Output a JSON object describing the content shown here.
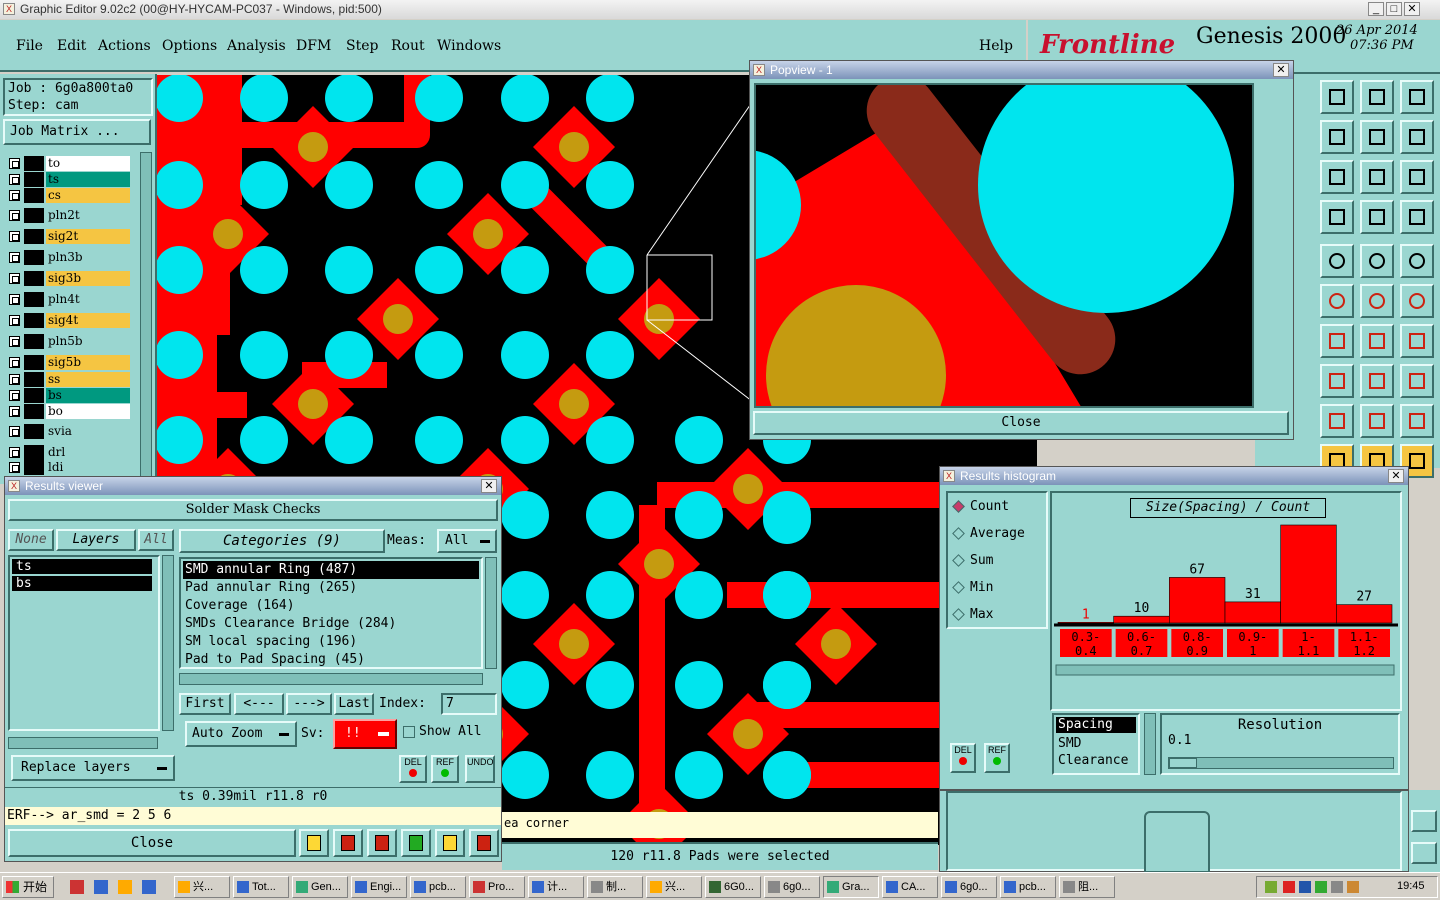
{
  "window": {
    "title": "Graphic Editor 9.02c2 (00@HY-HYCAM-PC037 - Windows, pid:500)"
  },
  "menu": [
    "File",
    "Edit",
    "Actions",
    "Options",
    "Analysis",
    "DFM",
    "Step",
    "Rout",
    "Windows"
  ],
  "help": "Help",
  "brand": {
    "logo": "Frontline",
    "product": "Genesis 2000",
    "date": "26 Apr 2014",
    "time": "07:36 PM"
  },
  "job": {
    "job_label": "Job  :  6g0a800ta0",
    "step_label": "Step: cam",
    "matrix_button": "Job Matrix ..."
  },
  "layers": [
    {
      "name": "to",
      "color": "#ffffff"
    },
    {
      "name": "ts",
      "color": "#009980"
    },
    {
      "name": "cs",
      "color": "#f5c542"
    },
    {
      "name": "pln2t",
      "color": "#9ad6d0"
    },
    {
      "name": "sig2t",
      "color": "#f5c542"
    },
    {
      "name": "pln3b",
      "color": "#9ad6d0"
    },
    {
      "name": "sig3b",
      "color": "#f5c542"
    },
    {
      "name": "pln4t",
      "color": "#9ad6d0"
    },
    {
      "name": "sig4t",
      "color": "#f5c542"
    },
    {
      "name": "pln5b",
      "color": "#9ad6d0"
    },
    {
      "name": "sig5b",
      "color": "#f5c542"
    },
    {
      "name": "ss",
      "color": "#f5c542"
    },
    {
      "name": "bs",
      "color": "#009980"
    },
    {
      "name": "bo",
      "color": "#ffffff"
    },
    {
      "name": "svia",
      "color": "#9ad6d0"
    },
    {
      "name": "drl",
      "color": "#9ad6d0"
    },
    {
      "name": "ldi",
      "color": "#9ad6d0"
    }
  ],
  "popview": {
    "title": "Popview - 1",
    "close": "Close"
  },
  "results_viewer": {
    "title": "Results viewer",
    "header": "Solder Mask Checks",
    "none": "None",
    "layers": "Layers",
    "all": "All",
    "layer_list": [
      "ts",
      "bs"
    ],
    "categories_label": "Categories (9)",
    "meas_label": "Meas:",
    "meas_value": "All",
    "categories": [
      "SMD annular Ring (487)",
      "Pad annular Ring (265)",
      "Coverage (164)",
      "SMDs Clearance Bridge (284)",
      "SM local spacing (196)",
      "Pad to Pad Spacing (45)"
    ],
    "first": "First",
    "prev": "<---",
    "next": "--->",
    "last": "Last",
    "index_label": "Index:",
    "index_value": "7",
    "auto_zoom": "Auto Zoom",
    "sv_label": "Sv:",
    "sv_value": "!!",
    "show_all": "Show All",
    "replace_layers": "Replace layers",
    "del": "DEL",
    "ref": "REF",
    "undo": "UNDO",
    "status": "ts 0.39mil   r11.8   r0",
    "erf": "ERF--> ar_smd = 2 5 6",
    "close": "Close"
  },
  "histogram": {
    "title": "Results histogram",
    "modes": [
      "Count",
      "Average",
      "Sum",
      "Min",
      "Max"
    ],
    "selected_mode": "Count",
    "chart_title": "Size(Spacing) / Count",
    "buckets": [
      {
        "label": "0.3-0.4",
        "count": 1
      },
      {
        "label": "0.6-0.7",
        "count": 10
      },
      {
        "label": "0.8-0.9",
        "count": 67
      },
      {
        "label": "0.9-1",
        "count": 31
      },
      {
        "label": "1-1.1",
        "count": 144
      },
      {
        "label": "1.1-1.2",
        "count": 27
      }
    ],
    "list": [
      "Spacing",
      "SMD",
      "Clearance"
    ],
    "resolution_label": "Resolution",
    "resolution_value": "0.1",
    "del": "DEL",
    "ref": "REF"
  },
  "chart_data": {
    "type": "bar",
    "title": "Size(Spacing) / Count",
    "categories": [
      "0.3-0.4",
      "0.6-0.7",
      "0.8-0.9",
      "0.9-1",
      "1-1.1",
      "1.1-1.2"
    ],
    "values": [
      1,
      10,
      67,
      31,
      144,
      27
    ]
  },
  "board_messages": {
    "corner_text": "ea corner",
    "selection": "120 r11.8 Pads were selected"
  },
  "taskbar": {
    "start": "开始",
    "items": [
      "兴...",
      "Tot...",
      "Gen...",
      "Engi...",
      "pcb...",
      "Pro...",
      "计...",
      "制...",
      "兴...",
      "6G0...",
      "6g0...",
      "Gra...",
      "CA...",
      "6g0...",
      "pcb...",
      "阻..."
    ],
    "clock": "19:45"
  }
}
